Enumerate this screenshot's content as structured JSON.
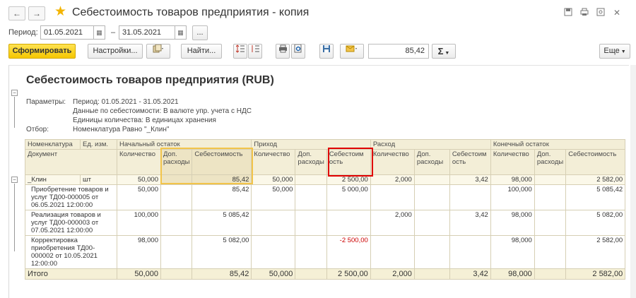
{
  "window": {
    "title": "Себестоимость товаров предприятия - копия",
    "back": "←",
    "forward": "→"
  },
  "period": {
    "label": "Период:",
    "from": "01.05.2021",
    "dash": "–",
    "to": "31.05.2021",
    "more": "..."
  },
  "toolbar": {
    "generate": "Сформировать",
    "settings": "Настройки...",
    "find": "Найти...",
    "sum_value": "85,42",
    "sum_symbol": "Σ",
    "more": "Еще"
  },
  "report": {
    "title": "Себестоимость товаров предприятия (RUB)",
    "params_label": "Параметры:",
    "params": [
      "Период: 01.05.2021 - 31.05.2021",
      "Данные по себестоимости: В валюте упр. учета с НДС",
      "Единицы количества: В единицах хранения"
    ],
    "filter_label": "Отбор:",
    "filter": "Номенклатура Равно \"_Клин\""
  },
  "table": {
    "h_nomenclature": "Номенклатура",
    "h_unit": "Ед. изм.",
    "h_document": "Документ",
    "groups": {
      "opening": "Начальный остаток",
      "income": "Приход",
      "expense": "Расход",
      "closing": "Конечный остаток"
    },
    "sub": {
      "qty": "Количество",
      "extra": "Доп. расходы",
      "cost": "Себестоимость",
      "cost_wrap": "Себестоим ость"
    },
    "rows": [
      {
        "name": "_Клин",
        "unit": "шт",
        "o_qty": "50,000",
        "o_extra": "",
        "o_cost": "85,42",
        "i_qty": "50,000",
        "i_extra": "",
        "i_cost": "2 500,00",
        "e_qty": "2,000",
        "e_extra": "",
        "e_cost": "3,42",
        "c_qty": "98,000",
        "c_extra": "",
        "c_cost": "2 582,00"
      },
      {
        "name": "Приобретение товаров и услуг ТД00-000005 от 06.05.2021 12:00:00",
        "unit": "",
        "o_qty": "50,000",
        "o_extra": "",
        "o_cost": "85,42",
        "i_qty": "50,000",
        "i_extra": "",
        "i_cost": "5 000,00",
        "e_qty": "",
        "e_extra": "",
        "e_cost": "",
        "c_qty": "100,000",
        "c_extra": "",
        "c_cost": "5 085,42"
      },
      {
        "name": "Реализация товаров и услуг ТД00-000003 от 07.05.2021 12:00:00",
        "unit": "",
        "o_qty": "100,000",
        "o_extra": "",
        "o_cost": "5 085,42",
        "i_qty": "",
        "i_extra": "",
        "i_cost": "",
        "e_qty": "2,000",
        "e_extra": "",
        "e_cost": "3,42",
        "c_qty": "98,000",
        "c_extra": "",
        "c_cost": "5 082,00"
      },
      {
        "name": "Корректировка приобретения ТД00-000002 от 10.05.2021 12:00:00",
        "unit": "",
        "o_qty": "98,000",
        "o_extra": "",
        "o_cost": "5 082,00",
        "i_qty": "",
        "i_extra": "",
        "i_cost": "-2 500,00",
        "e_qty": "",
        "e_extra": "",
        "e_cost": "",
        "c_qty": "98,000",
        "c_extra": "",
        "c_cost": "2 582,00"
      }
    ],
    "total": {
      "label": "Итого",
      "o_qty": "50,000",
      "o_extra": "",
      "o_cost": "85,42",
      "i_qty": "50,000",
      "i_extra": "",
      "i_cost": "2 500,00",
      "e_qty": "2,000",
      "e_extra": "",
      "e_cost": "3,42",
      "c_qty": "98,000",
      "c_extra": "",
      "c_cost": "2 582,00"
    }
  },
  "colors": {
    "accent_yellow": "#f5c700",
    "header_bg": "#f3eed7",
    "highlight_red": "#e00000",
    "negative": "#cc0000"
  }
}
